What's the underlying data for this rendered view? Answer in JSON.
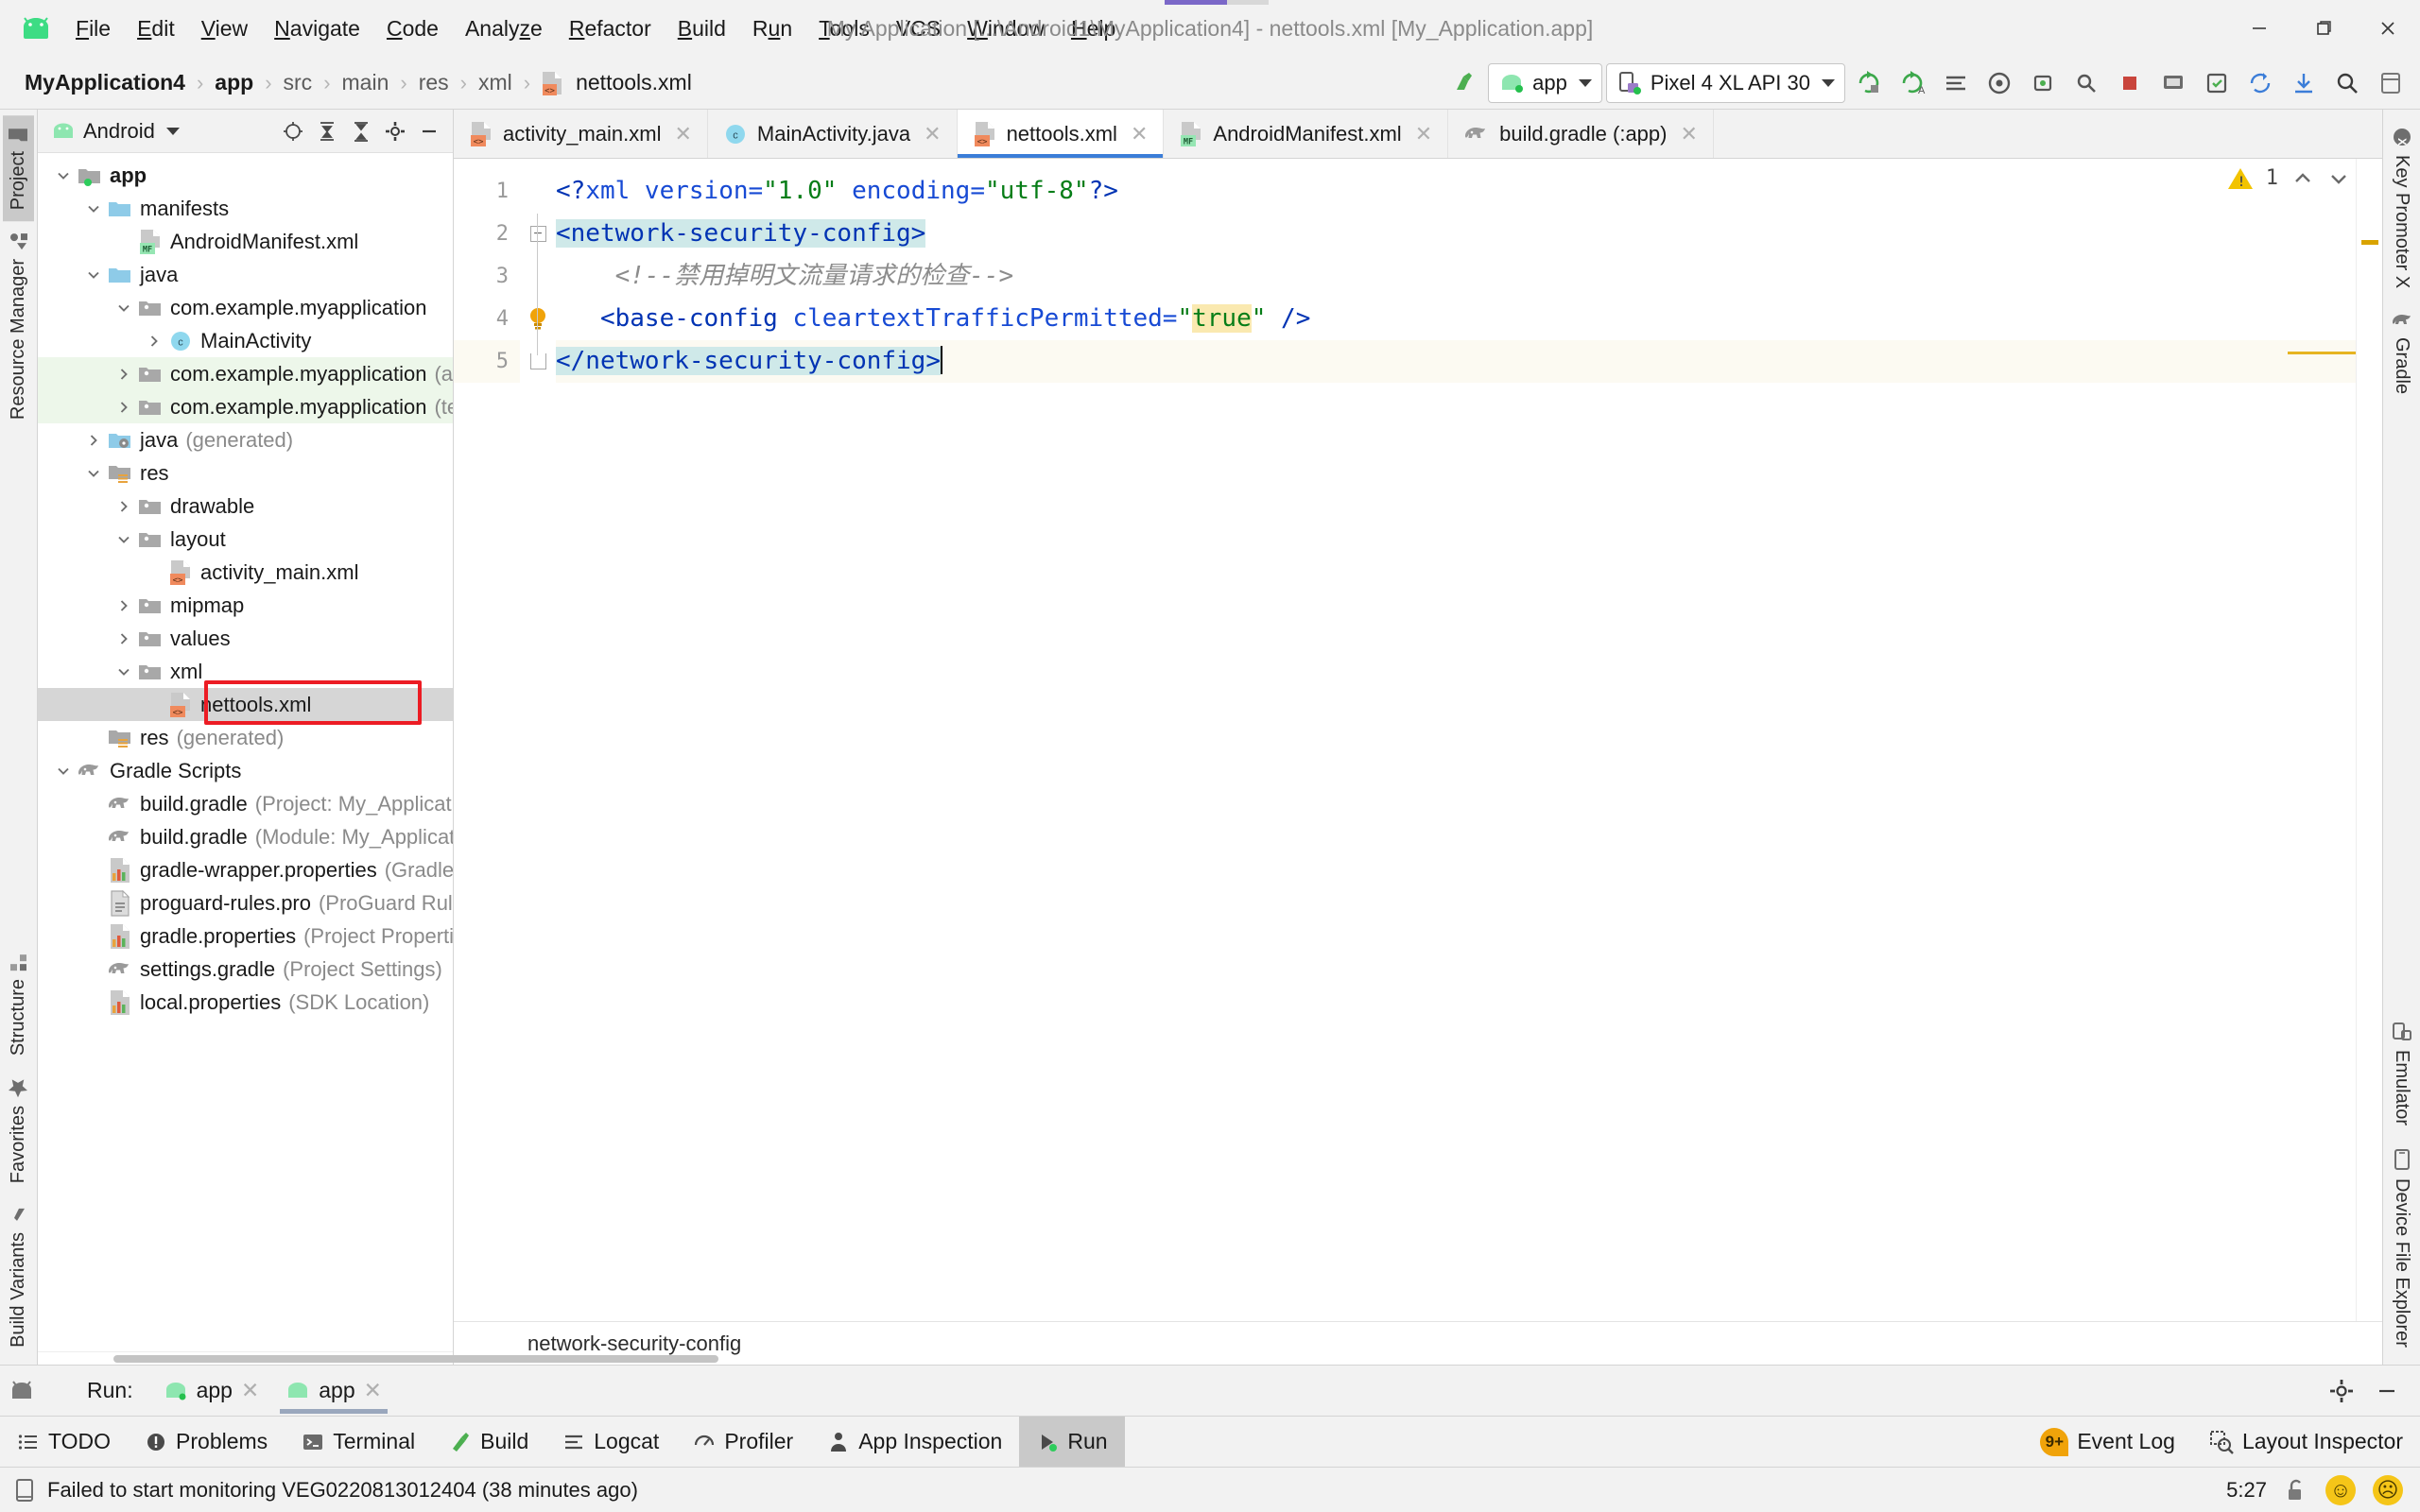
{
  "window": {
    "title": "My Application [...\\Android1\\MyApplication4] - nettools.xml [My_Application.app]",
    "minimize": "–",
    "maximize": "❐",
    "close": "✕"
  },
  "menubar": {
    "items": [
      {
        "label": "File",
        "mnemonic": "F"
      },
      {
        "label": "Edit",
        "mnemonic": "E"
      },
      {
        "label": "View",
        "mnemonic": "V"
      },
      {
        "label": "Navigate",
        "mnemonic": "N"
      },
      {
        "label": "Code",
        "mnemonic": "C"
      },
      {
        "label": "Analyze",
        "mnemonic": "z"
      },
      {
        "label": "Refactor",
        "mnemonic": "R"
      },
      {
        "label": "Build",
        "mnemonic": "B"
      },
      {
        "label": "Run",
        "mnemonic": "u"
      },
      {
        "label": "Tools",
        "mnemonic": "T"
      },
      {
        "label": "VCS",
        "mnemonic": ""
      },
      {
        "label": "Window",
        "mnemonic": "W"
      },
      {
        "label": "Help",
        "mnemonic": "H"
      }
    ]
  },
  "breadcrumb": {
    "items": [
      "MyApplication4",
      "app",
      "src",
      "main",
      "res",
      "xml",
      "nettools.xml"
    ],
    "separator": "›"
  },
  "toolbar": {
    "run_config": "app",
    "device": "Pixel 4 XL API 30",
    "icons": [
      "make-project-icon",
      "run-icon",
      "debug-icon",
      "run-with-coverage-icon",
      "profile-icon",
      "attach-debugger-icon",
      "stop-icon",
      "avd-manager-icon",
      "sdk-manager-icon",
      "sync-gradle-icon",
      "search-icon"
    ]
  },
  "left_strip": {
    "top": [
      {
        "label": "Project",
        "icon": "project-folder-icon",
        "active": true
      },
      {
        "label": "Resource Manager",
        "icon": "resource-manager-icon",
        "active": false
      }
    ],
    "bottom": [
      {
        "label": "Structure",
        "icon": "structure-icon"
      },
      {
        "label": "Favorites",
        "icon": "star-icon"
      },
      {
        "label": "Build Variants",
        "icon": "build-variants-icon"
      }
    ]
  },
  "right_strip": {
    "top": [
      {
        "label": "Key Promoter X",
        "icon": "key-promoter-icon"
      },
      {
        "label": "Gradle",
        "icon": "gradle-elephant-icon"
      }
    ],
    "bottom": [
      {
        "label": "Emulator",
        "icon": "emulator-icon"
      },
      {
        "label": "Device File Explorer",
        "icon": "device-icon"
      }
    ]
  },
  "project_panel": {
    "header": "Android",
    "header_icons": [
      "locate-icon",
      "expand-all-icon",
      "collapse-all-icon",
      "settings-icon",
      "hide-icon"
    ],
    "tree": [
      {
        "indent": 0,
        "arrow": "v",
        "icon": "module-icon",
        "label": "app",
        "sub": "",
        "bold": true,
        "state": ""
      },
      {
        "indent": 1,
        "arrow": "v",
        "icon": "folder-blue-icon",
        "label": "manifests",
        "sub": "",
        "bold": false,
        "state": ""
      },
      {
        "indent": 2,
        "arrow": "",
        "icon": "manifest-file-icon",
        "label": "AndroidManifest.xml",
        "sub": "",
        "bold": false,
        "state": ""
      },
      {
        "indent": 1,
        "arrow": "v",
        "icon": "folder-blue-icon",
        "label": "java",
        "sub": "",
        "bold": false,
        "state": ""
      },
      {
        "indent": 2,
        "arrow": "v",
        "icon": "package-icon",
        "label": "com.example.myapplication",
        "sub": "",
        "bold": false,
        "state": ""
      },
      {
        "indent": 3,
        "arrow": ">",
        "icon": "class-icon",
        "label": "MainActivity",
        "sub": "",
        "bold": false,
        "state": ""
      },
      {
        "indent": 2,
        "arrow": ">",
        "icon": "package-icon",
        "label": "com.example.myapplication",
        "sub": "(androidTest)",
        "bold": false,
        "state": "green"
      },
      {
        "indent": 2,
        "arrow": ">",
        "icon": "package-icon",
        "label": "com.example.myapplication",
        "sub": "(test)",
        "bold": false,
        "state": "green"
      },
      {
        "indent": 1,
        "arrow": ">",
        "icon": "folder-generated-icon",
        "label": "java",
        "sub": "(generated)",
        "bold": false,
        "state": ""
      },
      {
        "indent": 1,
        "arrow": "v",
        "icon": "res-folder-icon",
        "label": "res",
        "sub": "",
        "bold": false,
        "state": ""
      },
      {
        "indent": 2,
        "arrow": ">",
        "icon": "package-icon",
        "label": "drawable",
        "sub": "",
        "bold": false,
        "state": ""
      },
      {
        "indent": 2,
        "arrow": "v",
        "icon": "package-icon",
        "label": "layout",
        "sub": "",
        "bold": false,
        "state": ""
      },
      {
        "indent": 3,
        "arrow": "",
        "icon": "xml-file-icon",
        "label": "activity_main.xml",
        "sub": "",
        "bold": false,
        "state": ""
      },
      {
        "indent": 2,
        "arrow": ">",
        "icon": "package-icon",
        "label": "mipmap",
        "sub": "",
        "bold": false,
        "state": ""
      },
      {
        "indent": 2,
        "arrow": ">",
        "icon": "package-icon",
        "label": "values",
        "sub": "",
        "bold": false,
        "state": ""
      },
      {
        "indent": 2,
        "arrow": "v",
        "icon": "package-icon",
        "label": "xml",
        "sub": "",
        "bold": false,
        "state": ""
      },
      {
        "indent": 3,
        "arrow": "",
        "icon": "xml-file-icon",
        "label": "nettools.xml",
        "sub": "",
        "bold": false,
        "state": "selected"
      },
      {
        "indent": 1,
        "arrow": "",
        "icon": "res-folder-icon",
        "label": "res",
        "sub": "(generated)",
        "bold": false,
        "state": ""
      },
      {
        "indent": 0,
        "arrow": "v",
        "icon": "gradle-elephant-icon",
        "label": "Gradle Scripts",
        "sub": "",
        "bold": false,
        "state": ""
      },
      {
        "indent": 1,
        "arrow": "",
        "icon": "gradle-elephant-icon",
        "label": "build.gradle",
        "sub": "(Project: My_Application)",
        "bold": false,
        "state": ""
      },
      {
        "indent": 1,
        "arrow": "",
        "icon": "gradle-elephant-icon",
        "label": "build.gradle",
        "sub": "(Module: My_Application.app)",
        "bold": false,
        "state": ""
      },
      {
        "indent": 1,
        "arrow": "",
        "icon": "properties-file-icon",
        "label": "gradle-wrapper.properties",
        "sub": "(Gradle Version)",
        "bold": false,
        "state": ""
      },
      {
        "indent": 1,
        "arrow": "",
        "icon": "text-file-icon",
        "label": "proguard-rules.pro",
        "sub": "(ProGuard Rules for My_Applicatio",
        "bold": false,
        "state": ""
      },
      {
        "indent": 1,
        "arrow": "",
        "icon": "properties-file-icon",
        "label": "gradle.properties",
        "sub": "(Project Properties)",
        "bold": false,
        "state": ""
      },
      {
        "indent": 1,
        "arrow": "",
        "icon": "gradle-elephant-icon",
        "label": "settings.gradle",
        "sub": "(Project Settings)",
        "bold": false,
        "state": ""
      },
      {
        "indent": 1,
        "arrow": "",
        "icon": "properties-file-icon",
        "label": "local.properties",
        "sub": "(SDK Location)",
        "bold": false,
        "state": ""
      }
    ]
  },
  "editor": {
    "tabs": [
      {
        "label": "activity_main.xml",
        "icon": "xml-file-icon",
        "active": false
      },
      {
        "label": "MainActivity.java",
        "icon": "class-icon",
        "active": false
      },
      {
        "label": "nettools.xml",
        "icon": "xml-file-icon",
        "active": true
      },
      {
        "label": "AndroidManifest.xml",
        "icon": "manifest-file-icon",
        "active": false
      },
      {
        "label": "build.gradle (:app)",
        "icon": "gradle-elephant-icon",
        "active": false
      }
    ],
    "line_numbers": [
      "1",
      "2",
      "3",
      "4",
      "5"
    ],
    "code": {
      "l1_a": "<?",
      "l1_b": "xml version=",
      "l1_c": "\"1.0\"",
      "l1_d": " encoding=",
      "l1_e": "\"utf-8\"",
      "l1_f": "?>",
      "l2": "<network-security-config>",
      "l3": "<!--禁用掉明文流量请求的检查-->",
      "l4_a": "<base-config ",
      "l4_b": "cleartextTrafficPermitted=",
      "l4_c": "\"",
      "l4_d": "true",
      "l4_e": "\"",
      "l4_f": " />",
      "l5": "</network-security-config>"
    },
    "warning_count": "1",
    "warning_icon": "warning-triangle-icon",
    "nav_up": "⌃",
    "nav_down": "⌄",
    "status_breadcrumb": "network-security-config"
  },
  "run_panel": {
    "label": "Run:",
    "tabs": [
      {
        "label": "app",
        "active": false
      },
      {
        "label": "app",
        "active": true
      }
    ],
    "close": "✕",
    "settings_icon": "gear-icon",
    "hide_icon": "minimize-icon"
  },
  "toolwindow_bar": {
    "items": [
      {
        "label": "TODO",
        "icon": "todo-icon",
        "active": false
      },
      {
        "label": "Problems",
        "icon": "problems-icon",
        "active": false
      },
      {
        "label": "Terminal",
        "icon": "terminal-icon",
        "active": false
      },
      {
        "label": "Build",
        "icon": "build-hammer-icon",
        "active": false
      },
      {
        "label": "Logcat",
        "icon": "logcat-icon",
        "active": false
      },
      {
        "label": "Profiler",
        "icon": "profiler-icon",
        "active": false
      },
      {
        "label": "App Inspection",
        "icon": "app-inspection-icon",
        "active": false
      },
      {
        "label": "Run",
        "icon": "run-play-icon",
        "active": true
      }
    ],
    "right": [
      {
        "label": "Event Log",
        "icon": "event-log-icon",
        "badge": "9+"
      },
      {
        "label": "Layout Inspector",
        "icon": "layout-inspector-icon",
        "badge": ""
      }
    ]
  },
  "statusbar": {
    "message": "Failed to start monitoring VEG0220813012404 (38 minutes ago)",
    "message_icon": "device-icon",
    "time": "5:27",
    "lock_icon": "unlocked-icon",
    "smiley_happy": "☺",
    "smiley_sad": "☹"
  },
  "colors": {
    "accent_blue": "#3b7dd8",
    "android_green": "#3ddc84",
    "warning_yellow": "#f2c300",
    "annotation_red": "#ec1c24",
    "xml_tag": "#0033b3",
    "xml_string": "#067d17",
    "comment_grey": "#8c8c8c",
    "selection_teal": "#cfe9e9",
    "highlight_yellow": "#fae9b0"
  }
}
